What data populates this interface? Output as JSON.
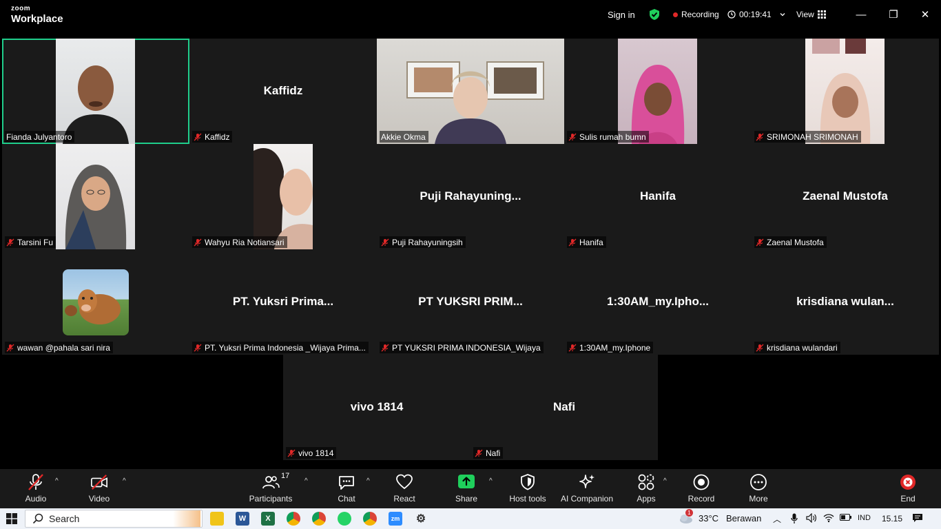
{
  "titlebar": {
    "logo_top": "zoom",
    "logo_bottom": "Workplace",
    "sign_in": "Sign in",
    "recording": "Recording",
    "timer": "00:19:41",
    "view": "View",
    "minimize": "—",
    "restore": "❐",
    "close": "✕"
  },
  "participants": [
    {
      "display": "",
      "label": "Fianda Julyantoro",
      "muted": false,
      "active": true,
      "video": "man"
    },
    {
      "display": "Kaffidz",
      "label": "Kaffidz",
      "muted": true
    },
    {
      "display": "",
      "label": "Akkie Okma",
      "muted": false,
      "video": "woman-room"
    },
    {
      "display": "",
      "label": "Sulis rumah bumn",
      "muted": true,
      "video": "woman-hijab-pink"
    },
    {
      "display": "",
      "label": "SRIMONAH SRIMONAH",
      "muted": true,
      "video": "woman-hijab-beige"
    },
    {
      "display": "",
      "label": "Tarsini Fu",
      "muted": true,
      "video": "woman-hijab-patterned"
    },
    {
      "display": "",
      "label": "Wahyu Ria Notiansari",
      "muted": true,
      "video": "woman-hair"
    },
    {
      "display": "Puji  Rahayuning...",
      "label": "Puji Rahayuningsih",
      "muted": true
    },
    {
      "display": "Hanifa",
      "label": "Hanifa",
      "muted": true
    },
    {
      "display": "Zaenal Mustofa",
      "label": "Zaenal Mustofa",
      "muted": true
    },
    {
      "display": "",
      "label": "wawan @pahala sari nira",
      "muted": true,
      "video": "cow"
    },
    {
      "display": "PT. Yuksri Prima...",
      "label": "PT. Yuksri Prima Indonesia _Wijaya Prima...",
      "muted": true
    },
    {
      "display": "PT YUKSRI PRIM...",
      "label": "PT YUKSRI PRIMA INDONESIA_Wijaya",
      "muted": true
    },
    {
      "display": "1:30AM_my.Ipho...",
      "label": "1:30AM_my.Iphone",
      "muted": true
    },
    {
      "display": "krisdiana  wulan...",
      "label": "krisdiana wulandari",
      "muted": true
    },
    {
      "display": "vivo 1814",
      "label": "vivo 1814",
      "muted": true
    },
    {
      "display": "Nafi",
      "label": "Nafi",
      "muted": true
    }
  ],
  "toolbar": {
    "audio": "Audio",
    "video": "Video",
    "participants": "Participants",
    "participants_count": "17",
    "chat": "Chat",
    "react": "React",
    "share": "Share",
    "host_tools": "Host tools",
    "ai_companion": "AI Companion",
    "apps": "Apps",
    "record": "Record",
    "more": "More",
    "end": "End"
  },
  "taskbar": {
    "search": "Search",
    "weather_temp": "33°C",
    "weather_desc": "Berawan",
    "weather_badge": "1",
    "lang": "IND",
    "time": "15.15",
    "app_word": "W",
    "app_excel": "X",
    "app_zoom": "zm"
  },
  "colors": {
    "active_border": "#1fcf8c",
    "recording": "#e02828",
    "share": "#1fcf5c",
    "end": "#e02828",
    "tile_bg": "#1a1a1a"
  }
}
